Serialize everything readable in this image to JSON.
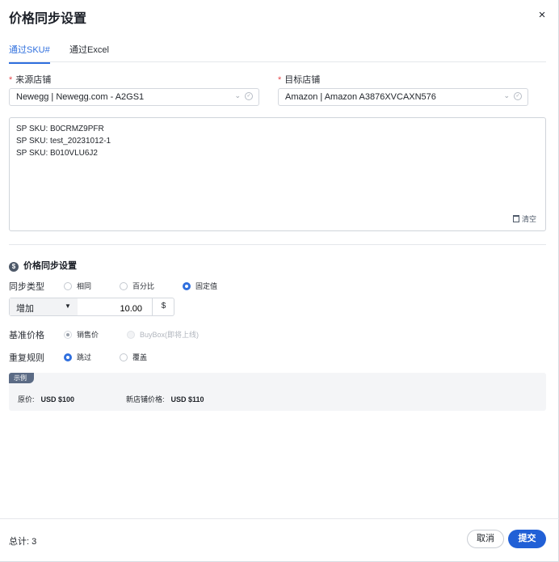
{
  "dialog": {
    "title": "价格同步设置",
    "close_icon": "×"
  },
  "tabs": [
    {
      "label": "通过SKU#",
      "active": true
    },
    {
      "label": "通过Excel",
      "active": false
    }
  ],
  "source_store": {
    "label": "来源店铺",
    "value": "Newegg | Newegg.com - A2GS1"
  },
  "target_store": {
    "label": "目标店铺",
    "value": "Amazon | Amazon A3876XVCAXN576"
  },
  "sku_input": {
    "lines": [
      "SP SKU: B0CRMZ9PFR",
      "SP SKU: test_20231012-1",
      "SP SKU: B010VLU6J2"
    ],
    "clear_label": "清空"
  },
  "price_sync": {
    "title": "价格同步设置",
    "icon": "$",
    "sync_type": {
      "label": "同步类型",
      "options": [
        "相同",
        "百分比",
        "固定值"
      ],
      "selected": "固定值"
    },
    "adjust": {
      "direction": "增加",
      "caret": "▼",
      "amount": "10.00",
      "unit": "$"
    },
    "base_price": {
      "label": "基准价格",
      "options": [
        "销售价",
        "BuyBox(即将上线)"
      ],
      "selected": "销售价"
    },
    "duplicate_rule": {
      "label": "重复规则",
      "options": [
        "跳过",
        "覆盖"
      ],
      "selected": "跳过"
    }
  },
  "example": {
    "tag": "示例",
    "original_label": "原价:",
    "original_value": "USD $100",
    "new_label": "新店铺价格:",
    "new_value": "USD $110"
  },
  "footer": {
    "total": "总计: 3",
    "cancel_label": "取消",
    "submit_label": "提交"
  },
  "colors": {
    "accent": "#2f6fde",
    "submit": "#2160d6",
    "required": "#e5484d"
  }
}
